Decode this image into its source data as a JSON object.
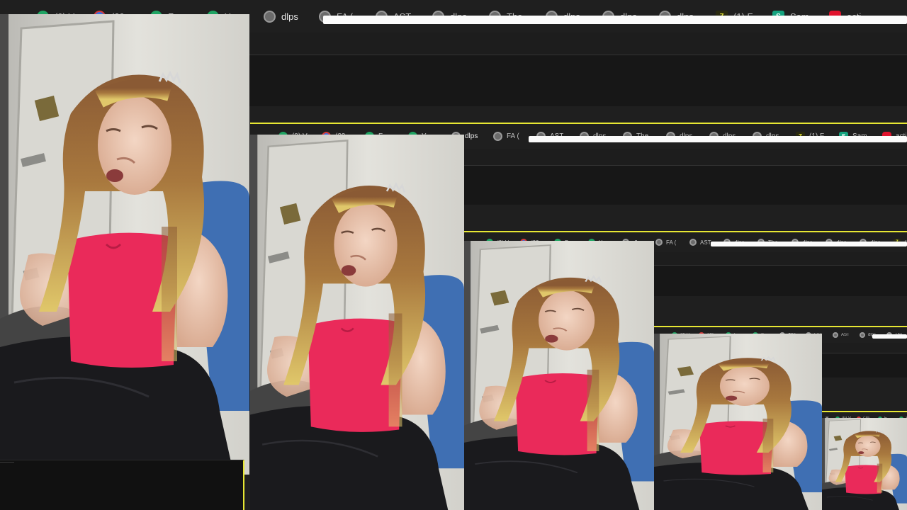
{
  "window": {
    "title": "dlps"
  },
  "tabs": [
    {
      "label": "(9) V",
      "icon": "green-circle-icon"
    },
    {
      "label": "(29",
      "icon": "messenger-icon"
    },
    {
      "label": "F",
      "icon": "green-circle-icon"
    },
    {
      "label": "Y",
      "icon": "green-circle-icon"
    },
    {
      "label": "dlps",
      "icon": "globe-icon",
      "active": true
    },
    {
      "label": "FA (",
      "icon": "globe-icon"
    },
    {
      "label": "AST",
      "icon": "globe-icon"
    },
    {
      "label": "dlps",
      "icon": "globe-icon"
    },
    {
      "label": "The",
      "icon": "globe-icon"
    },
    {
      "label": "dlps",
      "icon": "globe-icon"
    },
    {
      "label": "dlps",
      "icon": "globe-icon"
    },
    {
      "label": "dlps",
      "icon": "globe-icon"
    },
    {
      "label": "(1) F",
      "icon": "yellow-app-icon"
    },
    {
      "label": "Sam",
      "icon": "teal-s-icon"
    },
    {
      "label": "acti",
      "icon": "youtube-icon"
    }
  ],
  "address_bar": {
    "value": ""
  },
  "colors": {
    "frame_border": "#e7e733",
    "toolbar_bg": "#1f1f1f",
    "panel_bg": "#1d1d1d",
    "address_bg": "#fbfbfb"
  }
}
